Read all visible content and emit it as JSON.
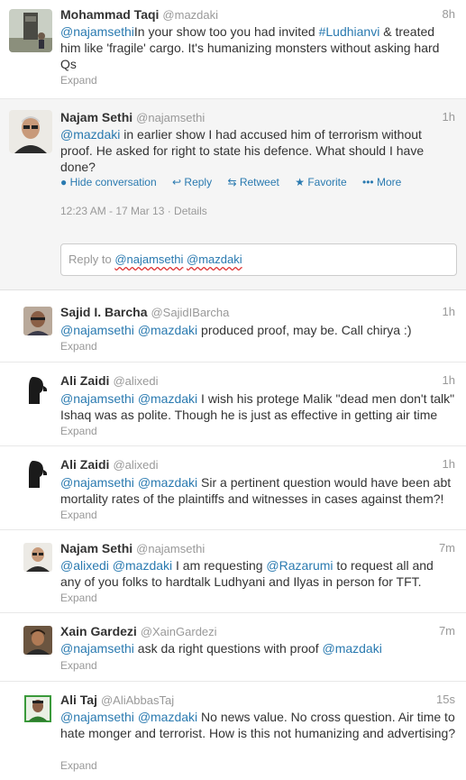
{
  "tweets": [
    {
      "name": "Mohammad Taqi",
      "handle": "@mazdaki",
      "time": "8h",
      "segments": [
        {
          "t": "link",
          "v": "@najamsethi"
        },
        {
          "t": "text",
          "v": "In your show too you had invited "
        },
        {
          "t": "link",
          "v": "#Ludhianvi"
        },
        {
          "t": "text",
          "v": " & treated him like 'fragile' cargo. It's humanizing monsters without asking hard Qs"
        }
      ],
      "expand": "Expand"
    },
    {
      "name": "Najam Sethi",
      "handle": "@najamsethi",
      "time": "1h",
      "segments": [
        {
          "t": "link",
          "v": "@mazdaki"
        },
        {
          "t": "text",
          "v": " in earlier show I had accused him of terrorism without proof. He asked for right to state his defence. What should I have done?"
        }
      ],
      "actions": [
        "Hide conversation",
        "Reply",
        "Retweet",
        "Favorite",
        "More"
      ],
      "meta": "12:23 AM - 17 Mar 13 · Details"
    },
    {
      "name": "Sajid I. Barcha",
      "handle": "@SajidIBarcha",
      "time": "1h",
      "segments": [
        {
          "t": "link",
          "v": "@najamsethi"
        },
        {
          "t": "text",
          "v": " "
        },
        {
          "t": "link",
          "v": "@mazdaki"
        },
        {
          "t": "text",
          "v": " produced proof, may be. Call chirya :)"
        }
      ],
      "expand": "Expand"
    },
    {
      "name": "Ali Zaidi",
      "handle": "@alixedi",
      "time": "1h",
      "segments": [
        {
          "t": "link",
          "v": "@najamsethi"
        },
        {
          "t": "text",
          "v": " "
        },
        {
          "t": "link",
          "v": "@mazdaki"
        },
        {
          "t": "text",
          "v": " I wish his protege Malik \"dead men don't talk\" Ishaq was as polite. Though he is just as effective in getting air time"
        }
      ],
      "expand": "Expand"
    },
    {
      "name": "Ali Zaidi",
      "handle": "@alixedi",
      "time": "1h",
      "segments": [
        {
          "t": "link",
          "v": "@najamsethi"
        },
        {
          "t": "text",
          "v": " "
        },
        {
          "t": "link",
          "v": "@mazdaki"
        },
        {
          "t": "text",
          "v": " Sir a pertinent question would have been abt mortality rates of the plaintiffs and witnesses in cases against them?!"
        }
      ],
      "expand": "Expand"
    },
    {
      "name": "Najam Sethi",
      "handle": "@najamsethi",
      "time": "7m",
      "segments": [
        {
          "t": "link",
          "v": "@alixedi"
        },
        {
          "t": "text",
          "v": " "
        },
        {
          "t": "link",
          "v": "@mazdaki"
        },
        {
          "t": "text",
          "v": " I am requesting "
        },
        {
          "t": "link",
          "v": "@Razarumi"
        },
        {
          "t": "text",
          "v": " to request all and any of you folks to hardtalk Ludhyani and Ilyas in person for TFT."
        }
      ],
      "expand": "Expand"
    },
    {
      "name": "Xain Gardezi",
      "handle": "@XainGardezi",
      "time": "7m",
      "segments": [
        {
          "t": "link",
          "v": "@najamsethi"
        },
        {
          "t": "text",
          "v": " ask da right questions with proof "
        },
        {
          "t": "link",
          "v": "@mazdaki"
        }
      ],
      "expand": "Expand"
    },
    {
      "name": "Ali Taj",
      "handle": "@AliAbbasTaj",
      "time": "15s",
      "segments": [
        {
          "t": "link",
          "v": "@najamsethi"
        },
        {
          "t": "text",
          "v": " "
        },
        {
          "t": "link",
          "v": "@mazdaki"
        },
        {
          "t": "text",
          "v": " No news value. No cross question. Air time to hate monger and terrorist. How is this not humanizing and advertising?"
        }
      ],
      "expand": "Expand"
    }
  ],
  "reply_box": {
    "prefix": "Reply to",
    "mention1": "@najamsethi",
    "mention2": "@mazdaki"
  },
  "colors": {
    "link": "#2a7ab0",
    "muted": "#999999",
    "text": "#333333",
    "corner_badge": "#5ab03e"
  }
}
